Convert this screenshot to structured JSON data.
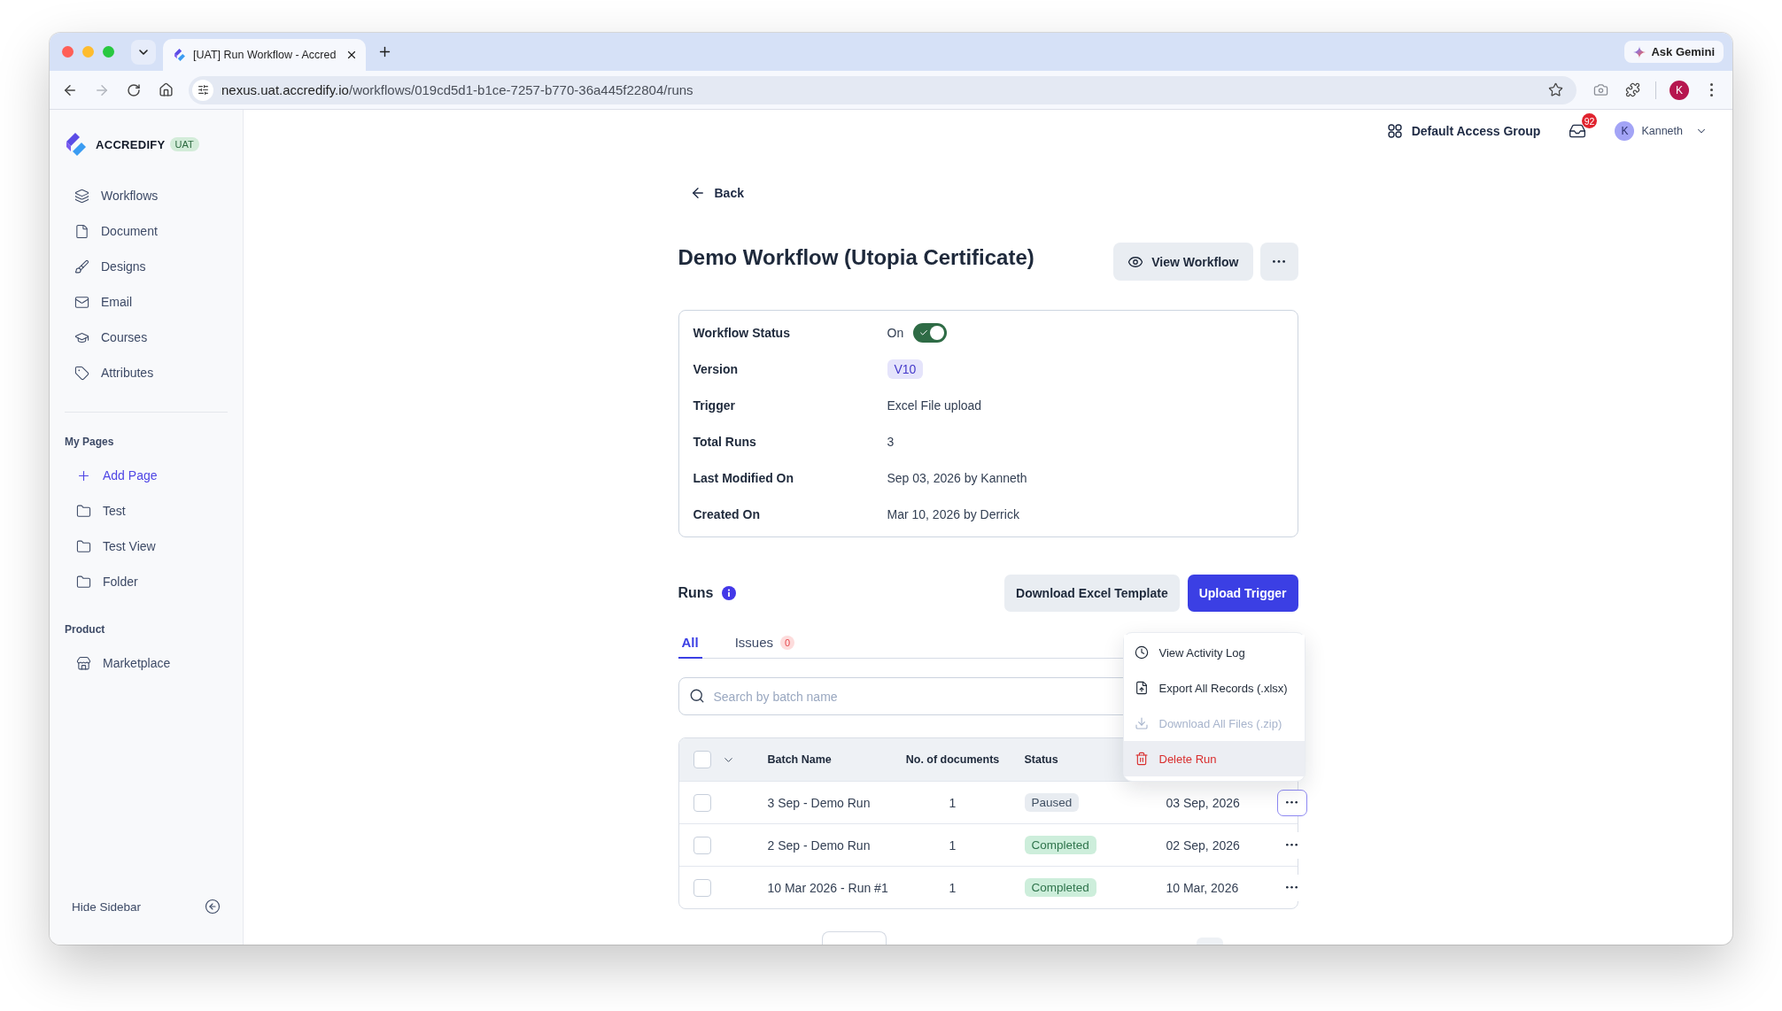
{
  "browser": {
    "tab": {
      "title": "[UAT] Run Workflow - Accred",
      "selected": true
    },
    "ask_button": "Ask Gemini",
    "forward_disabled": true,
    "url": "nexus.uat.accredify.io/workflows/019cd5d1-b1ce-7257-b770-36a445f22804/runs",
    "profile_initial": "K"
  },
  "sidebar": {
    "brand": "ACCREDIFY",
    "env_badge": "UAT",
    "items": [
      {
        "label": "Workflows",
        "selected": false
      },
      {
        "label": "Document",
        "selected": false
      },
      {
        "label": "Designs",
        "selected": false
      },
      {
        "label": "Email",
        "selected": false
      },
      {
        "label": "Courses",
        "selected": false
      },
      {
        "label": "Attributes",
        "selected": false
      }
    ],
    "sections": [
      {
        "title": "My Pages",
        "items": [
          {
            "label": "Add Page",
            "kind": "add",
            "selected": false
          },
          {
            "label": "Test",
            "kind": "page",
            "selected": false
          },
          {
            "label": "Test View",
            "kind": "page",
            "selected": false
          },
          {
            "label": "Folder",
            "kind": "page",
            "selected": false
          }
        ]
      },
      {
        "title": "Product",
        "items": [
          {
            "label": "Marketplace",
            "kind": "app",
            "selected": false
          }
        ]
      }
    ],
    "hide_label": "Hide Sidebar"
  },
  "header": {
    "access_group": "Default Access Group",
    "notification_count": "92",
    "user": {
      "initial": "K",
      "name": "Kanneth"
    }
  },
  "page": {
    "back": "Back",
    "title": "Demo Workflow (Utopia Certificate)",
    "view_button": "View Workflow"
  },
  "details": {
    "rows": [
      {
        "label": "Workflow Status",
        "kind": "toggle",
        "value": "On",
        "on": true
      },
      {
        "label": "Version",
        "kind": "tag",
        "value": "V10"
      },
      {
        "label": "Trigger",
        "kind": "text",
        "value": "Excel File upload"
      },
      {
        "label": "Total Runs",
        "kind": "text",
        "value": "3"
      },
      {
        "label": "Last Modified On",
        "kind": "text",
        "value": "Sep 03, 2026 by Kanneth"
      },
      {
        "label": "Created On",
        "kind": "text",
        "value": "Mar 10, 2026 by Derrick"
      }
    ]
  },
  "runs": {
    "title": "Runs",
    "buttons": [
      {
        "label": "Download Excel Template",
        "kind": "secondary"
      },
      {
        "label": "Upload Trigger",
        "kind": "primary"
      }
    ],
    "tabs": [
      {
        "label": "All",
        "selected": true
      },
      {
        "label": "Issues",
        "count": "0",
        "selected": false
      }
    ],
    "search": {
      "placeholder": "Search by batch name"
    },
    "table": {
      "all_checked": false,
      "columns": [
        "Batch Name",
        "No. of documents",
        "Status"
      ],
      "rows": [
        {
          "checked": false,
          "batch_name": "3 Sep - Demo Run",
          "documents": "1",
          "status": {
            "label": "Paused",
            "color": "#e8ecf1"
          },
          "date": "03 Sep, 2026",
          "menu_open": true
        },
        {
          "checked": false,
          "batch_name": "2 Sep - Demo Run",
          "documents": "1",
          "status": {
            "label": "Completed",
            "color": "#cdeedb"
          },
          "date": "02 Sep, 2026",
          "menu_open": false
        },
        {
          "checked": false,
          "batch_name": "10 Mar 2026 - Run #1",
          "documents": "1",
          "status": {
            "label": "Completed",
            "color": "#cdeedb"
          },
          "date": "10 Mar, 2026",
          "menu_open": false
        }
      ]
    },
    "row_menu": {
      "items": [
        {
          "label": "View Activity Log",
          "kind": "normal",
          "disabled": false,
          "highlighted": false
        },
        {
          "label": "Export All Records (.xlsx)",
          "kind": "normal",
          "disabled": false,
          "highlighted": false
        },
        {
          "label": "Download All Files (.zip)",
          "kind": "normal",
          "disabled": true,
          "highlighted": false
        },
        {
          "label": "Delete Run",
          "kind": "danger",
          "disabled": false,
          "highlighted": true
        }
      ]
    }
  }
}
